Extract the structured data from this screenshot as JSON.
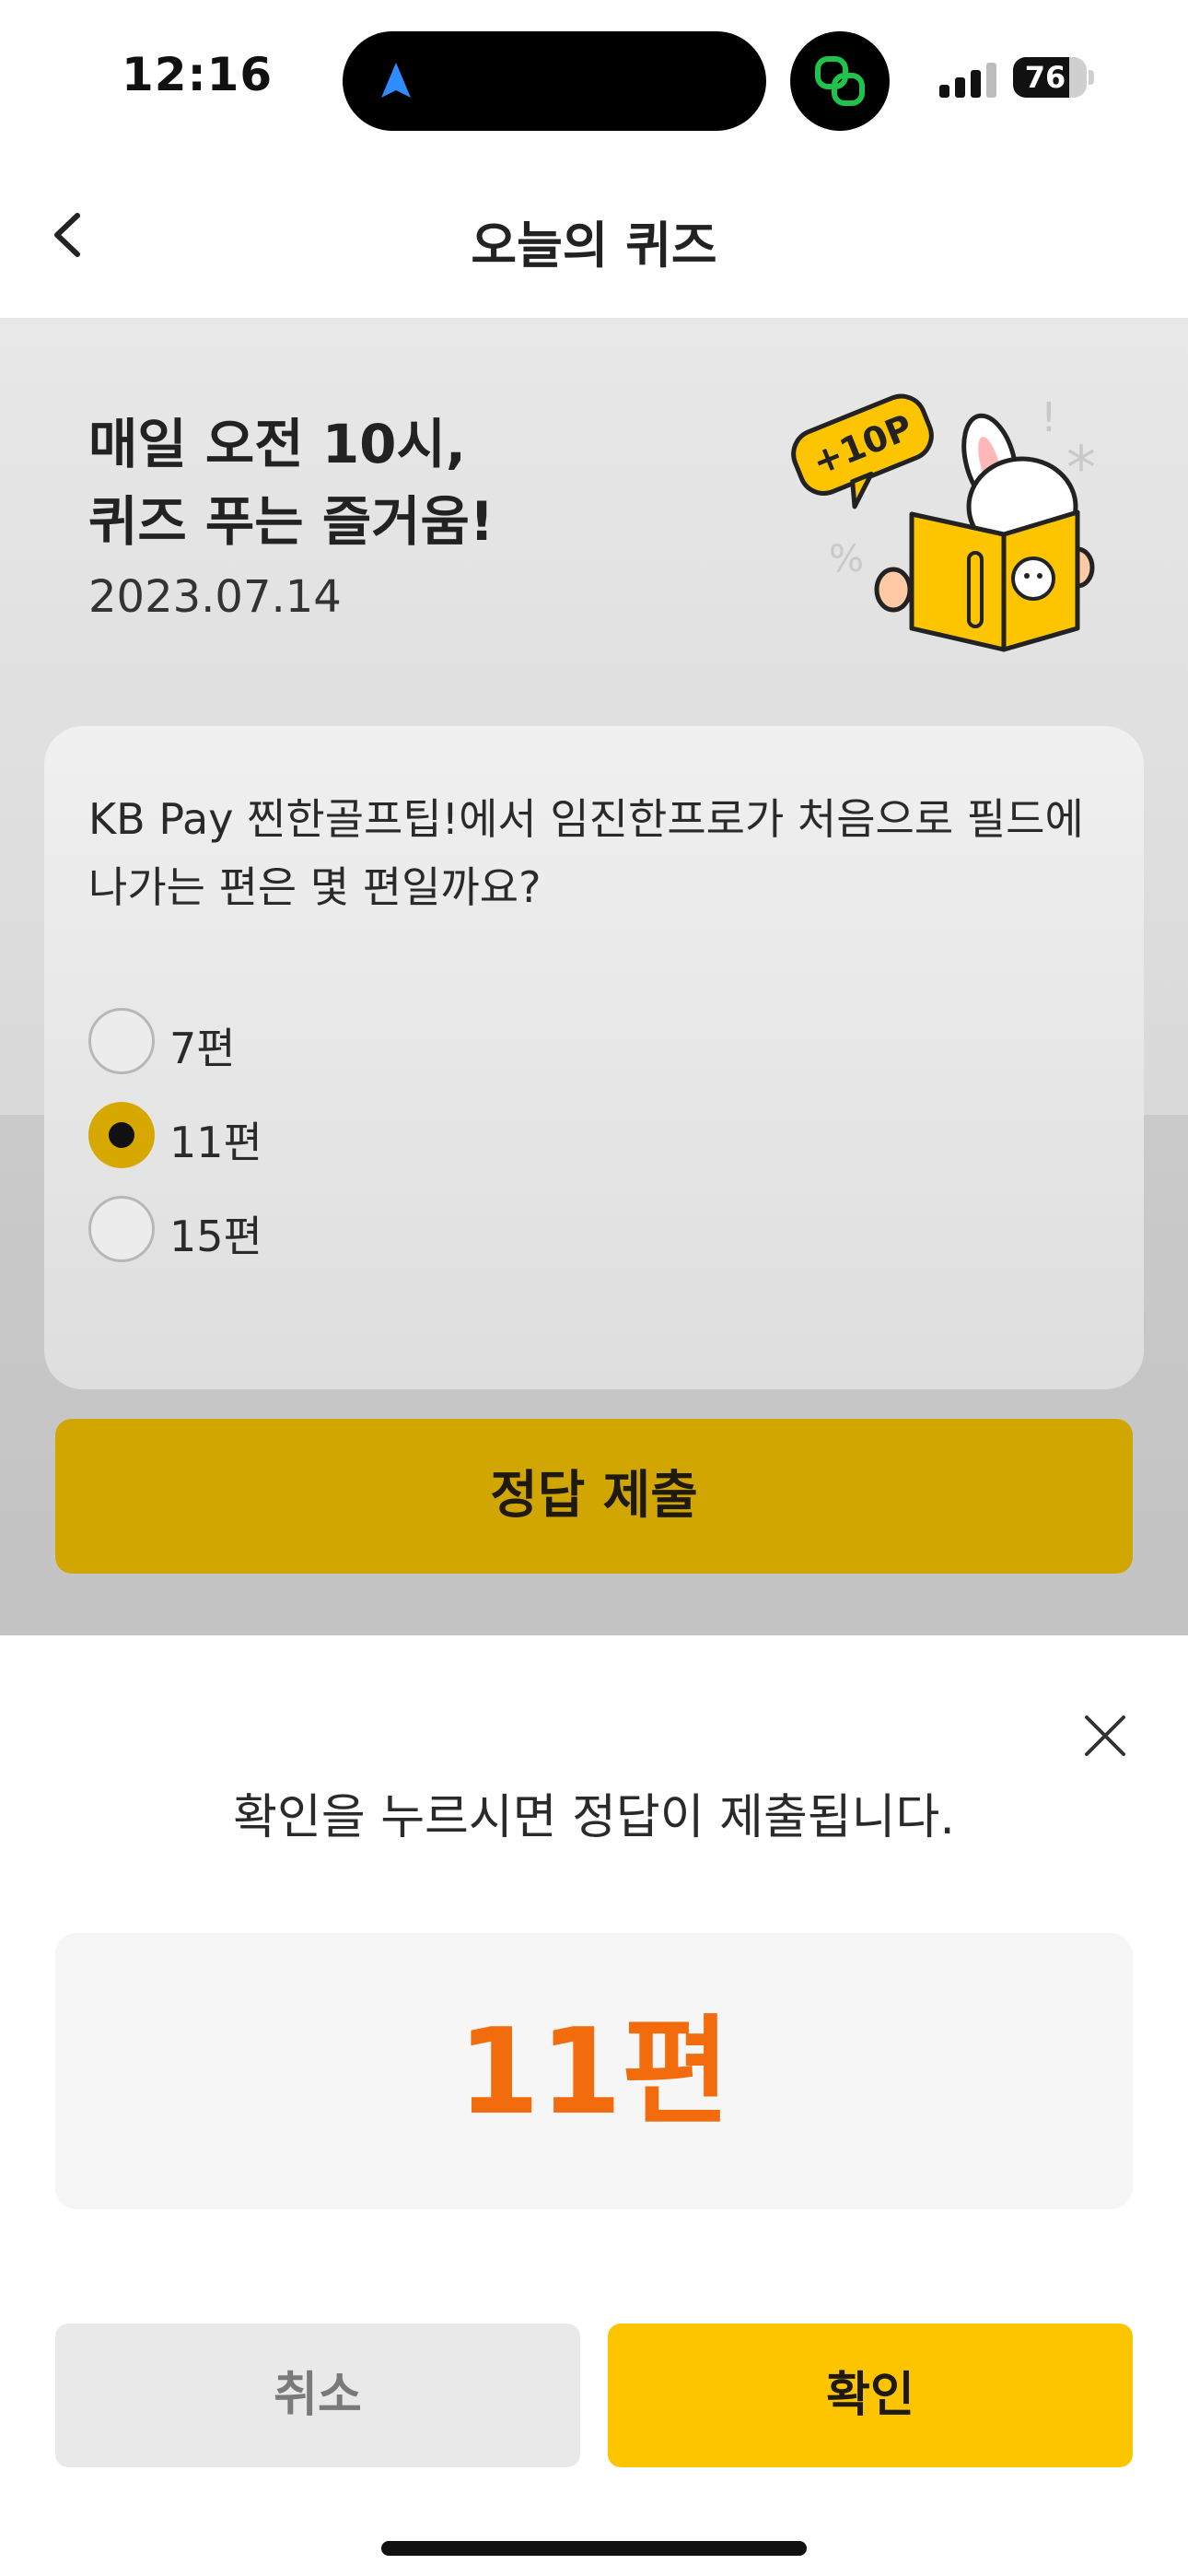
{
  "status_bar": {
    "time": "12:16",
    "battery": "76",
    "battery_level": 0.76
  },
  "header": {
    "title": "오늘의 퀴즈"
  },
  "hero": {
    "title": "매일 오전 10시,\n퀴즈 푸는 즐거움!",
    "date": "2023.07.14",
    "badge": "+10P"
  },
  "quiz": {
    "question": "KB Pay 찐한골프팁!에서 임진한프로가 처음으로 필드에 나가는 편은 몇 편일까요?",
    "options": [
      {
        "label": "7편",
        "selected": false
      },
      {
        "label": "11편",
        "selected": true
      },
      {
        "label": "15편",
        "selected": false
      }
    ],
    "submit_label": "정답 제출"
  },
  "sheet": {
    "message": "확인을 누르시면 정답이 제출됩니다.",
    "answer": "11편",
    "cancel_label": "취소",
    "confirm_label": "확인"
  },
  "colors": {
    "accent": "#fcc500",
    "answer": "#f26c0d",
    "selected_radio": "#d6a800"
  },
  "icons": [
    "navigation-arrow-icon",
    "link-app-icon",
    "signal-icon",
    "battery-icon",
    "back-chevron-icon",
    "close-icon",
    "bunny-reading-illustration"
  ]
}
